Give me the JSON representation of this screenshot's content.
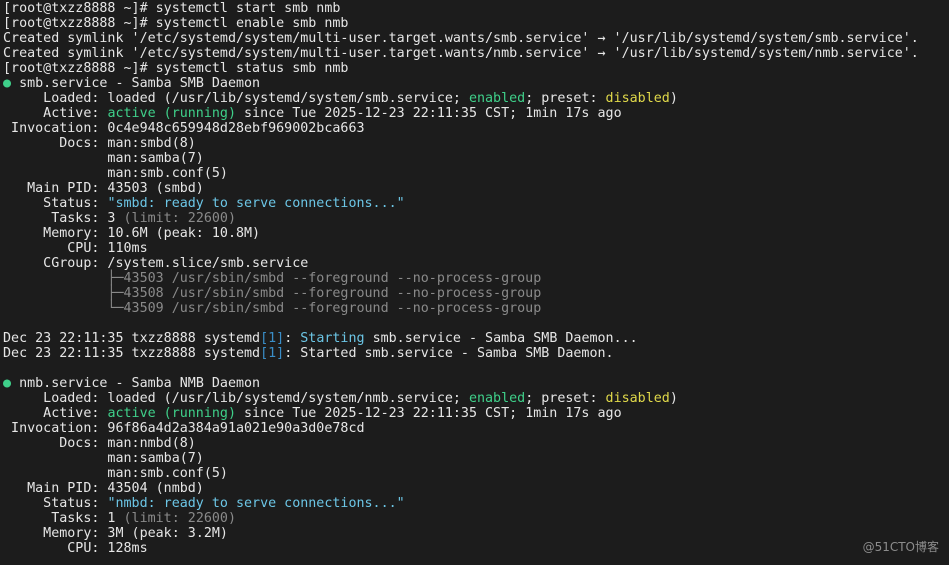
{
  "terminal": {
    "lines": [
      [
        [
          "[root@txzz8888 ~]# systemctl start smb nmb",
          ""
        ]
      ],
      [
        [
          "[root@txzz8888 ~]# systemctl enable smb nmb",
          ""
        ]
      ],
      [
        [
          "Created symlink '/etc/systemd/system/multi-user.target.wants/smb.service' → '/usr/lib/systemd/system/smb.service'.",
          ""
        ]
      ],
      [
        [
          "Created symlink '/etc/systemd/system/multi-user.target.wants/nmb.service' → '/usr/lib/systemd/system/nmb.service'.",
          ""
        ]
      ],
      [
        [
          "[root@txzz8888 ~]# systemctl status smb nmb",
          ""
        ]
      ],
      [
        [
          "●",
          "dot"
        ],
        [
          " smb.service - Samba SMB Daemon",
          ""
        ]
      ],
      [
        [
          "     Loaded: loaded (/usr/lib/systemd/system/smb.service; ",
          ""
        ],
        [
          "enabled",
          "g"
        ],
        [
          "; preset: ",
          ""
        ],
        [
          "disabled",
          "y"
        ],
        [
          ")",
          ""
        ]
      ],
      [
        [
          "     Active: ",
          ""
        ],
        [
          "active (running)",
          "g"
        ],
        [
          " since Tue 2025-12-23 22:11:35 CST; 1min 17s ago",
          ""
        ]
      ],
      [
        [
          " Invocation: 0c4e948c659948d28ebf969002bca663",
          ""
        ]
      ],
      [
        [
          "       Docs: man:smbd(8)",
          ""
        ]
      ],
      [
        [
          "             man:samba(7)",
          ""
        ]
      ],
      [
        [
          "             man:smb.conf(5)",
          ""
        ]
      ],
      [
        [
          "   Main PID: 43503 (smbd)",
          ""
        ]
      ],
      [
        [
          "     Status: ",
          ""
        ],
        [
          "\"smbd: ready to serve connections...\"",
          "c"
        ]
      ],
      [
        [
          "      Tasks: 3 ",
          ""
        ],
        [
          "(limit: 22600)",
          "d"
        ]
      ],
      [
        [
          "     Memory: 10.6M (peak: 10.8M)",
          ""
        ]
      ],
      [
        [
          "        CPU: 110ms",
          ""
        ]
      ],
      [
        [
          "     CGroup: /system.slice/smb.service",
          ""
        ]
      ],
      [
        [
          "             ├─43503 /usr/sbin/smbd --foreground --no-process-group",
          "d"
        ]
      ],
      [
        [
          "             ├─43508 /usr/sbin/smbd --foreground --no-process-group",
          "d"
        ]
      ],
      [
        [
          "             └─43509 /usr/sbin/smbd --foreground --no-process-group",
          "d"
        ]
      ],
      [
        [
          "",
          ""
        ]
      ],
      [
        [
          "Dec 23 22:11:35 txzz8888 systemd",
          ""
        ],
        [
          "[1]",
          "b"
        ],
        [
          ": ",
          ""
        ],
        [
          "Starting",
          "c"
        ],
        [
          " smb.service - Samba SMB Daemon...",
          ""
        ]
      ],
      [
        [
          "Dec 23 22:11:35 txzz8888 systemd",
          ""
        ],
        [
          "[1]",
          "b"
        ],
        [
          ": Started smb.service - Samba SMB Daemon.",
          ""
        ]
      ],
      [
        [
          "",
          ""
        ]
      ],
      [
        [
          "●",
          "dot"
        ],
        [
          " nmb.service - Samba NMB Daemon",
          ""
        ]
      ],
      [
        [
          "     Loaded: loaded (/usr/lib/systemd/system/nmb.service; ",
          ""
        ],
        [
          "enabled",
          "g"
        ],
        [
          "; preset: ",
          ""
        ],
        [
          "disabled",
          "y"
        ],
        [
          ")",
          ""
        ]
      ],
      [
        [
          "     Active: ",
          ""
        ],
        [
          "active (running)",
          "g"
        ],
        [
          " since Tue 2025-12-23 22:11:35 CST; 1min 17s ago",
          ""
        ]
      ],
      [
        [
          " Invocation: 96f86a4d2a384a91a021e90a3d0e78cd",
          ""
        ]
      ],
      [
        [
          "       Docs: man:nmbd(8)",
          ""
        ]
      ],
      [
        [
          "             man:samba(7)",
          ""
        ]
      ],
      [
        [
          "             man:smb.conf(5)",
          ""
        ]
      ],
      [
        [
          "   Main PID: 43504 (nmbd)",
          ""
        ]
      ],
      [
        [
          "     Status: ",
          ""
        ],
        [
          "\"nmbd: ready to serve connections...\"",
          "c"
        ]
      ],
      [
        [
          "      Tasks: 1 ",
          ""
        ],
        [
          "(limit: 22600)",
          "d"
        ]
      ],
      [
        [
          "     Memory: 3M (peak: 3.2M)",
          ""
        ]
      ],
      [
        [
          "        CPU: 128ms",
          ""
        ]
      ]
    ]
  },
  "watermark": "@51CTO博客"
}
